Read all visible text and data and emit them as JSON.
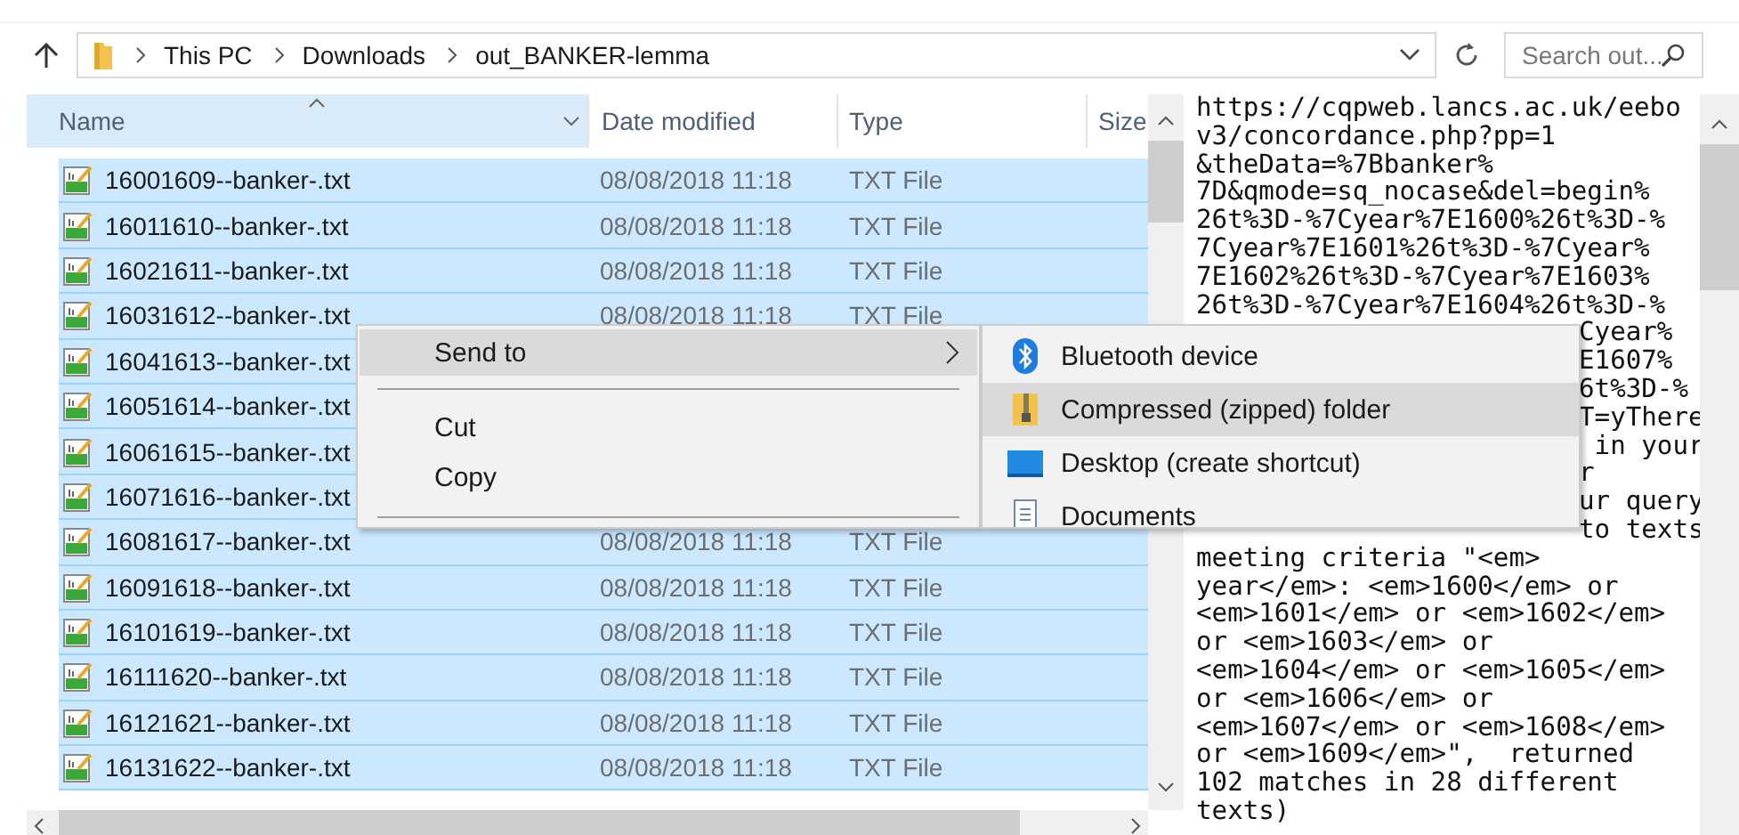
{
  "address_bar": {
    "crumbs": [
      "This PC",
      "Downloads",
      "out_BANKER-lemma"
    ]
  },
  "search": {
    "placeholder": "Search out..."
  },
  "table": {
    "columns": [
      {
        "label": "Name",
        "sorted": true
      },
      {
        "label": "Date modified",
        "sorted": false
      },
      {
        "label": "Type",
        "sorted": false
      },
      {
        "label": "Size",
        "sorted": false
      }
    ],
    "rows": [
      {
        "name": "16001609--banker-.txt",
        "date": "08/08/2018 11:18",
        "type": "TXT File",
        "selected": true
      },
      {
        "name": "16011610--banker-.txt",
        "date": "08/08/2018 11:18",
        "type": "TXT File",
        "selected": true
      },
      {
        "name": "16021611--banker-.txt",
        "date": "08/08/2018 11:18",
        "type": "TXT File",
        "selected": true
      },
      {
        "name": "16031612--banker-.txt",
        "date": "08/08/2018 11:18",
        "type": "TXT File",
        "selected": true
      },
      {
        "name": "16041613--banker-.txt",
        "selected": true
      },
      {
        "name": "16051614--banker-.txt",
        "selected": true
      },
      {
        "name": "16061615--banker-.txt",
        "selected": true
      },
      {
        "name": "16071616--banker-.txt",
        "selected": true
      },
      {
        "name": "16081617--banker-.txt",
        "date": "08/08/2018 11:18",
        "type": "TXT File",
        "selected": true
      },
      {
        "name": "16091618--banker-.txt",
        "date": "08/08/2018 11:18",
        "type": "TXT File",
        "selected": true
      },
      {
        "name": "16101619--banker-.txt",
        "date": "08/08/2018 11:18",
        "type": "TXT File",
        "selected": true
      },
      {
        "name": "16111620--banker-.txt",
        "date": "08/08/2018 11:18",
        "type": "TXT File",
        "selected": true
      },
      {
        "name": "16121621--banker-.txt",
        "date": "08/08/2018 11:18",
        "type": "TXT File",
        "selected": true
      },
      {
        "name": "16131622--banker-.txt",
        "date": "08/08/2018 11:18",
        "type": "TXT File",
        "selected": true
      }
    ]
  },
  "context_menu": {
    "items": [
      {
        "kind": "submenu",
        "label": "Send to",
        "selected": true
      },
      {
        "kind": "separator"
      },
      {
        "kind": "item",
        "label": "Cut",
        "selected": false
      },
      {
        "kind": "item",
        "label": "Copy",
        "selected": false
      },
      {
        "kind": "separator"
      }
    ],
    "submenu": [
      {
        "kind": "bluetooth",
        "label": "Bluetooth device",
        "selected": false
      },
      {
        "kind": "zip",
        "label": "Compressed (zipped) folder",
        "selected": true
      },
      {
        "kind": "desktop",
        "label": "Desktop (create shortcut)",
        "selected": false
      },
      {
        "kind": "documents",
        "label": "Documents",
        "selected": false
      }
    ]
  },
  "text_pane": {
    "lines": [
      {
        "kind": "full",
        "text": "https://cqpweb.lancs.ac.uk/eebo"
      },
      {
        "kind": "full",
        "text": "v3/concordance.php?pp=1"
      },
      {
        "kind": "full",
        "text": "&theData=%7Bbanker%"
      },
      {
        "kind": "full",
        "text": "7D&qmode=sq_nocase&del=begin%"
      },
      {
        "kind": "full",
        "text": "26t%3D-%7Cyear%7E1600%26t%3D-%"
      },
      {
        "kind": "full",
        "text": "7Cyear%7E1601%26t%3D-%7Cyear%"
      },
      {
        "kind": "full",
        "text": "7E1602%26t%3D-%7Cyear%7E1603%"
      },
      {
        "kind": "full",
        "text": "26t%3D-%7Cyear%7E1604%26t%3D-%"
      },
      {
        "kind": "covered",
        "text": "Cyear%"
      },
      {
        "kind": "covered",
        "text": "E1607%"
      },
      {
        "kind": "covered",
        "text": "6t%3D-%"
      },
      {
        "kind": "covered",
        "text": "T=yThere"
      },
      {
        "kind": "covered",
        "text": " in your"
      },
      {
        "kind": "covered",
        "text": "r"
      },
      {
        "kind": "covered",
        "text": "ur query"
      },
      {
        "kind": "covered",
        "text": "to texts"
      },
      {
        "kind": "full",
        "text": "meeting criteria \"<em>"
      },
      {
        "kind": "full",
        "text": "year</em>: <em>1600</em> or"
      },
      {
        "kind": "full",
        "text": "<em>1601</em> or <em>1602</em>"
      },
      {
        "kind": "full",
        "text": "or <em>1603</em> or"
      },
      {
        "kind": "full",
        "text": "<em>1604</em> or <em>1605</em>"
      },
      {
        "kind": "full",
        "text": "or <em>1606</em> or"
      },
      {
        "kind": "full",
        "text": "<em>1607</em> or <em>1608</em>"
      },
      {
        "kind": "full",
        "text": "or <em>1609</em>\",  returned"
      },
      {
        "kind": "full",
        "text": "102 matches in 28 different"
      },
      {
        "kind": "full",
        "text": "texts)"
      }
    ]
  }
}
